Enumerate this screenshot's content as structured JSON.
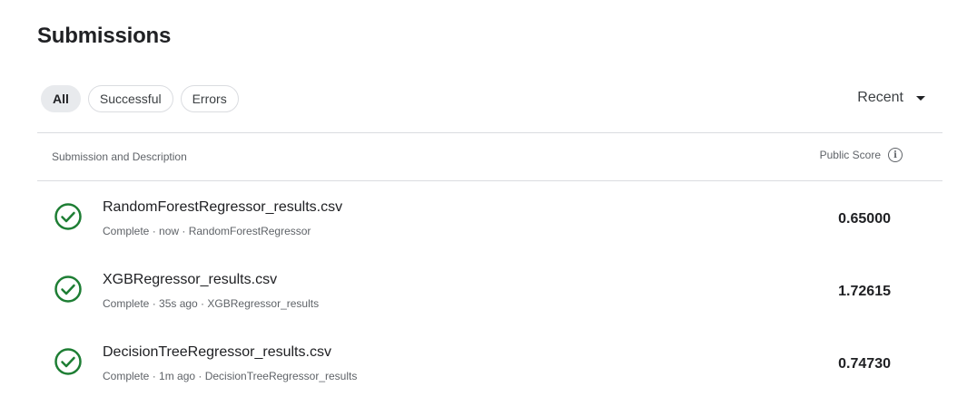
{
  "page": {
    "title": "Submissions"
  },
  "filters": [
    "All",
    "Successful",
    "Errors"
  ],
  "sort": {
    "label": "Recent"
  },
  "table": {
    "col_left": "Submission and Description",
    "col_right": "Public Score",
    "rows": [
      {
        "file": "RandomForestRegressor_results.csv",
        "meta": "Complete · now · RandomForestRegressor",
        "score": "0.65000"
      },
      {
        "file": "XGBRegressor_results.csv",
        "meta": "Complete · 35s ago · XGBRegressor_results",
        "score": "1.72615"
      },
      {
        "file": "DecisionTreeRegressor_results.csv",
        "meta": "Complete · 1m ago · DecisionTreeRegressor_results",
        "score": "0.74730"
      }
    ]
  },
  "colors": {
    "success": "#1e7e34",
    "text": "#202124",
    "muted": "#5f6368",
    "border": "#dadce0"
  },
  "icons": {
    "status": "check-circle-icon",
    "info": "info-icon",
    "sort": "caret-down-icon"
  }
}
